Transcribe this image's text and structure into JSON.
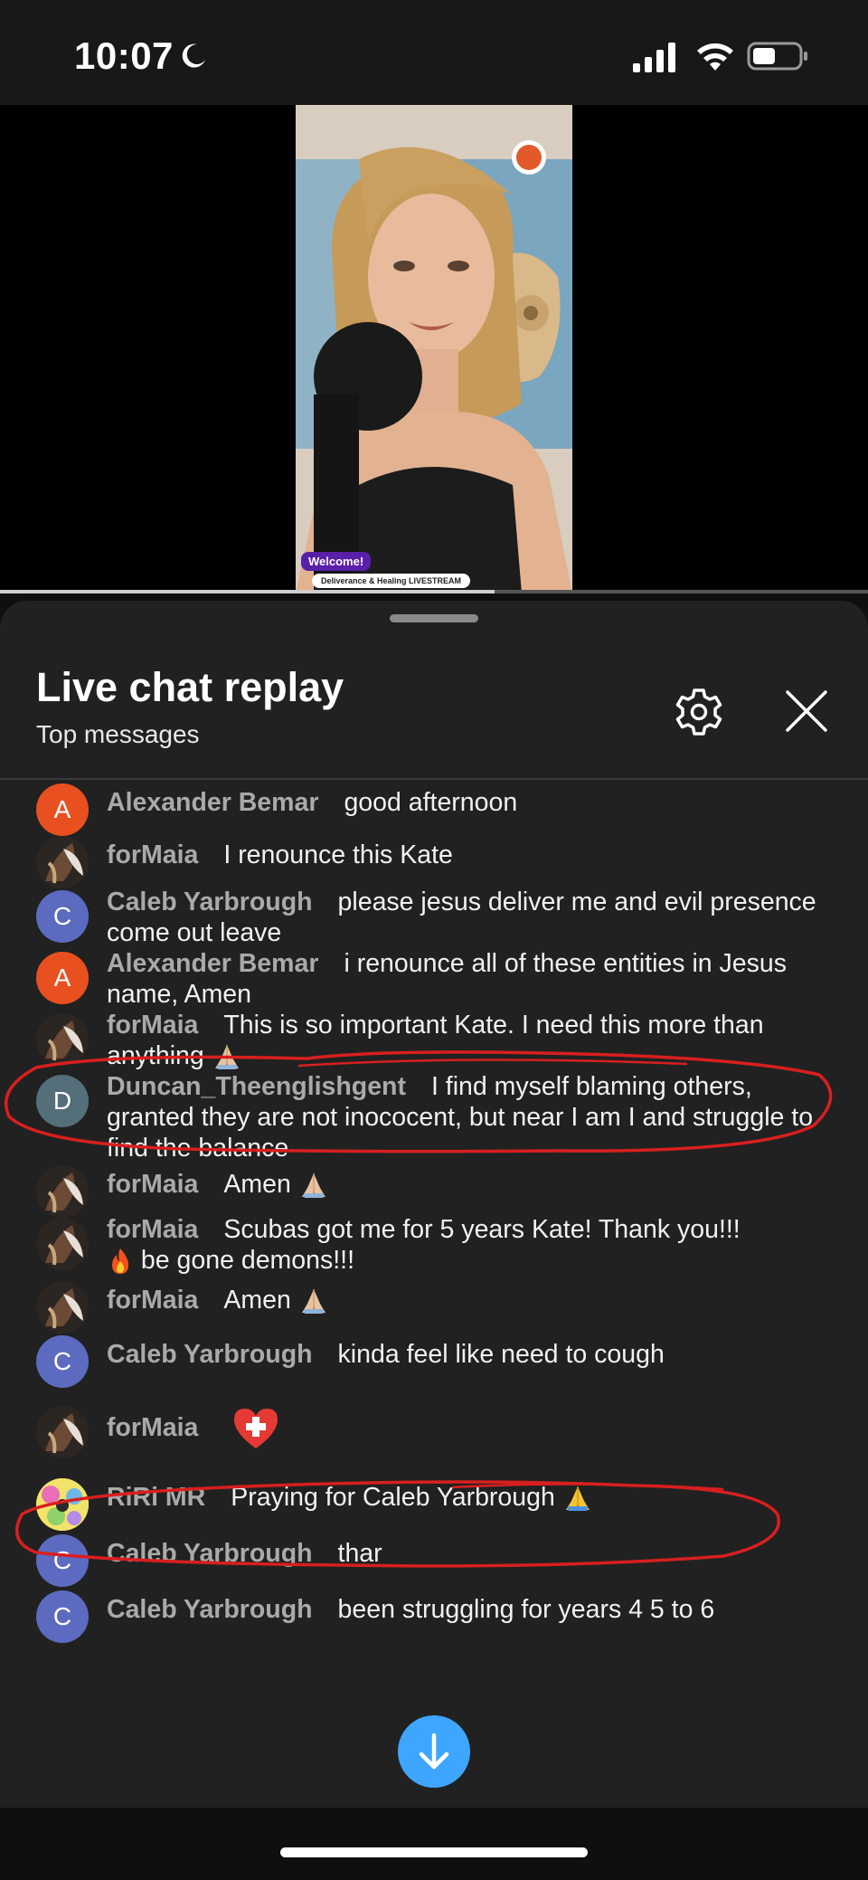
{
  "status_bar": {
    "time": "10:07"
  },
  "video": {
    "welcome_label": "Welcome!",
    "stream_label": "Deliverance & Healing LIVESTREAM",
    "progress_fraction": 0.57
  },
  "panel": {
    "title": "Live chat replay",
    "subtitle": "Top messages"
  },
  "messages": [
    {
      "author": "Alexander Bemar",
      "text": "good afternoon",
      "avatar_letter": "A",
      "avatar_color": "#e8501f"
    },
    {
      "author": "forMaia",
      "text": "I renounce this Kate",
      "avatar_letter": "",
      "avatar_color": "#2b2622"
    },
    {
      "author": "Caleb Yarbrough",
      "text": "please jesus deliver me and evil presence come out leave",
      "avatar_letter": "C",
      "avatar_color": "#5c6bc0"
    },
    {
      "author": "Alexander Bemar",
      "text": "i renounce all of these entities in Jesus name, Amen",
      "avatar_letter": "A",
      "avatar_color": "#e8501f"
    },
    {
      "author": "forMaia",
      "text": "This is so important Kate. I need this more than anything",
      "avatar_letter": "",
      "avatar_color": "#2b2622"
    },
    {
      "author": "Duncan_Theenglishgent",
      "text": "I find myself blaming others, granted they are not inococent, but near I am I and struggle to find the balance",
      "avatar_letter": "D",
      "avatar_color": "#546e7a"
    },
    {
      "author": "forMaia",
      "text": "Amen",
      "avatar_letter": "",
      "avatar_color": "#2b2622"
    },
    {
      "author": "forMaia",
      "text": "Scubas got me for 5 years Kate! Thank you!!!",
      "text2": "be gone demons!!!",
      "avatar_letter": "",
      "avatar_color": "#2b2622"
    },
    {
      "author": "forMaia",
      "text": "Amen",
      "avatar_letter": "",
      "avatar_color": "#2b2622"
    },
    {
      "author": "Caleb Yarbrough",
      "text": "kinda feel like need to cough",
      "avatar_letter": "C",
      "avatar_color": "#5c6bc0"
    },
    {
      "author": "forMaia",
      "text": "",
      "avatar_letter": "",
      "avatar_color": "#2b2622"
    },
    {
      "author": "RiRi MR",
      "text": "Praying for Caleb Yarbrough",
      "avatar_letter": "",
      "avatar_color": "#f2e46a"
    },
    {
      "author": "Caleb Yarbrough",
      "text": "thar",
      "avatar_letter": "C",
      "avatar_color": "#5c6bc0"
    },
    {
      "author": "Caleb Yarbrough",
      "text": "been struggling for years 4 5 to 6",
      "avatar_letter": "C",
      "avatar_color": "#5c6bc0"
    }
  ],
  "icons": {
    "settings": "gear-icon",
    "close": "close-icon",
    "fullscreen": "fullscreen-icon",
    "scroll_down": "arrow-down-icon",
    "pray": "folded-hands-emoji",
    "fire": "fire-emoji",
    "medical": "red-cross-heart-emoji"
  },
  "colors": {
    "annotation_red": "#d81f1f",
    "accent_blue": "#3ea6ff"
  }
}
